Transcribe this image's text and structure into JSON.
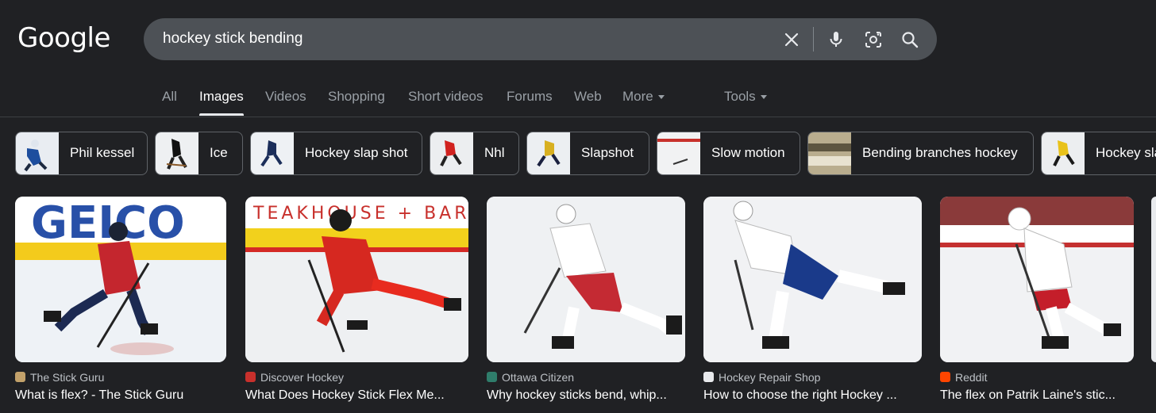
{
  "header": {
    "logo": "Google",
    "search_query": "hockey stick bending"
  },
  "tabs": {
    "all": "All",
    "images": "Images",
    "videos": "Videos",
    "shopping": "Shopping",
    "short_videos": "Short videos",
    "forums": "Forums",
    "web": "Web",
    "more": "More",
    "tools": "Tools"
  },
  "chips": [
    {
      "label": "Phil kessel"
    },
    {
      "label": "Ice"
    },
    {
      "label": "Hockey slap shot"
    },
    {
      "label": "Nhl"
    },
    {
      "label": "Slapshot"
    },
    {
      "label": "Slow motion"
    },
    {
      "label": "Bending branches hockey"
    },
    {
      "label": "Hockey sla"
    }
  ],
  "results": [
    {
      "source": "The Stick Guru",
      "title": "What is flex? - The Stick Guru"
    },
    {
      "source": "Discover Hockey",
      "title": "What Does Hockey Stick Flex Me..."
    },
    {
      "source": "Ottawa Citizen",
      "title": "Why hockey sticks bend, whip..."
    },
    {
      "source": "Hockey Repair Shop",
      "title": "How to choose the right Hockey ..."
    },
    {
      "source": "Reddit",
      "title": "The flex on Patrik Laine's stic..."
    }
  ],
  "colors": {
    "background": "#202124",
    "search_bar": "#4d5156",
    "text_primary": "#ffffff",
    "text_secondary": "#9aa0a6"
  }
}
